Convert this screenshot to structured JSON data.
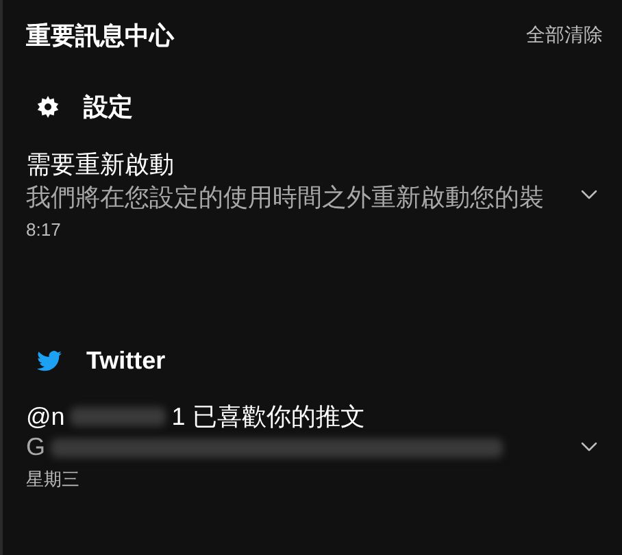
{
  "header": {
    "title": "重要訊息中心",
    "clear_all": "全部清除"
  },
  "groups": [
    {
      "app": "設定",
      "kind": "gear",
      "notifications": [
        {
          "title_parts": [
            "需要重新啟動"
          ],
          "body_parts": [
            "我們將在您設定的使用時間之外重新啟動您的裝"
          ],
          "redacted": false,
          "time": "8:17"
        }
      ]
    },
    {
      "app": "Twitter",
      "kind": "bird",
      "notifications": [
        {
          "title_parts": [
            "@n",
            "1 已喜歡你的推文"
          ],
          "body_parts": [
            "G"
          ],
          "redacted": true,
          "time": "星期三"
        }
      ]
    }
  ]
}
